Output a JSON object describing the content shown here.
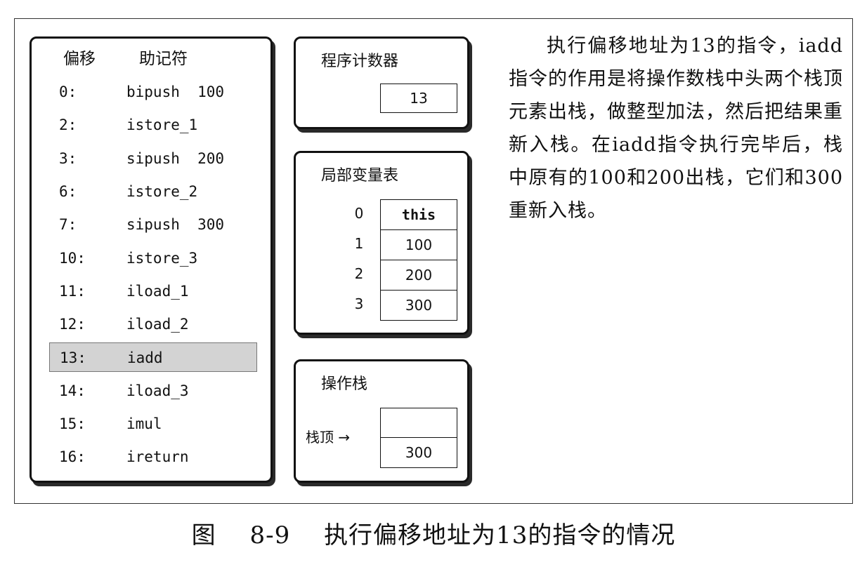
{
  "bytecode": {
    "header_offset": "偏移",
    "header_mnemonic": "助记符",
    "rows": [
      {
        "offset": "0:",
        "instr": "bipush  100"
      },
      {
        "offset": "2:",
        "instr": "istore_1"
      },
      {
        "offset": "3:",
        "instr": "sipush  200"
      },
      {
        "offset": "6:",
        "instr": "istore_2"
      },
      {
        "offset": "7:",
        "instr": "sipush  300"
      },
      {
        "offset": "10:",
        "instr": "istore_3"
      },
      {
        "offset": "11:",
        "instr": "iload_1"
      },
      {
        "offset": "12:",
        "instr": "iload_2"
      },
      {
        "offset": "13:",
        "instr": "iadd"
      },
      {
        "offset": "14:",
        "instr": "iload_3"
      },
      {
        "offset": "15:",
        "instr": "imul"
      },
      {
        "offset": "16:",
        "instr": "ireturn"
      }
    ],
    "highlight_index": 8
  },
  "pc": {
    "title": "程序计数器",
    "value": "13"
  },
  "local_vars": {
    "title": "局部变量表",
    "rows": [
      {
        "index": "0",
        "value": "this"
      },
      {
        "index": "1",
        "value": "100"
      },
      {
        "index": "2",
        "value": "200"
      },
      {
        "index": "3",
        "value": "300"
      }
    ]
  },
  "operand_stack": {
    "title": "操作栈",
    "top_label": "栈顶",
    "top_arrow": "→",
    "cells": [
      "",
      "300"
    ]
  },
  "description": "执行偏移地址为13的指令，iadd指令的作用是将操作数栈中头两个栈顶元素出栈，做整型加法，然后把结果重新入栈。在iadd指令执行完毕后，栈中原有的100和200出栈，它们和300重新入栈。",
  "caption": {
    "label": "图",
    "number": "8-9",
    "text": "执行偏移地址为13的指令的情况"
  }
}
